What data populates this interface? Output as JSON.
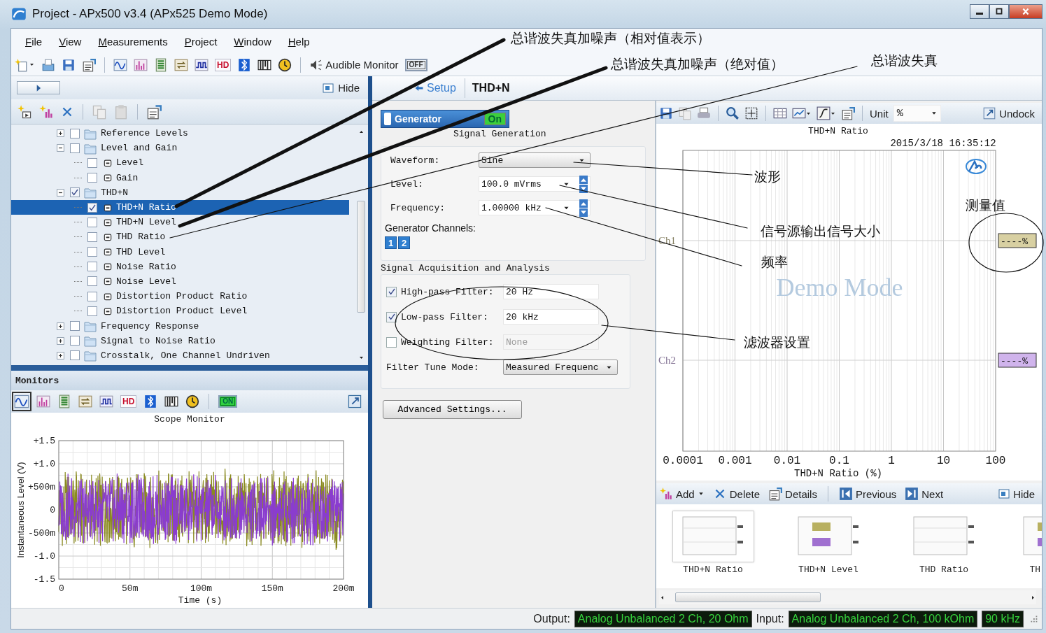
{
  "window": {
    "title": "Project - APx500 v3.4 (APx525 Demo Mode)"
  },
  "menu": [
    {
      "label": "File"
    },
    {
      "label": "View"
    },
    {
      "label": "Measurements"
    },
    {
      "label": "Project"
    },
    {
      "label": "Window"
    },
    {
      "label": "Help"
    }
  ],
  "toolbar": {
    "hd_label": "HD",
    "audible_monitor": "Audible Monitor",
    "monitor_switch": {
      "label": "OFF",
      "on": false
    }
  },
  "navigator": {
    "hide_button": "Hide",
    "tree": [
      {
        "label": "Reference Levels",
        "kind": "folder",
        "checked": false,
        "expanded": false,
        "selected": false
      },
      {
        "label": "Level and Gain",
        "kind": "folder",
        "checked": false,
        "expanded": true,
        "selected": false,
        "children": [
          {
            "label": "Level",
            "kind": "measurement",
            "checked": false,
            "selected": false
          },
          {
            "label": "Gain",
            "kind": "measurement",
            "checked": false,
            "selected": false
          }
        ]
      },
      {
        "label": "THD+N",
        "kind": "folder",
        "checked": true,
        "expanded": true,
        "selected": false,
        "children": [
          {
            "label": "THD+N Ratio",
            "kind": "measurement",
            "checked": true,
            "selected": true
          },
          {
            "label": "THD+N Level",
            "kind": "measurement",
            "checked": false,
            "selected": false
          },
          {
            "label": "THD Ratio",
            "kind": "measurement",
            "checked": false,
            "selected": false
          },
          {
            "label": "THD Level",
            "kind": "measurement",
            "checked": false,
            "selected": false
          },
          {
            "label": "Noise Ratio",
            "kind": "measurement",
            "checked": false,
            "selected": false
          },
          {
            "label": "Noise Level",
            "kind": "measurement",
            "checked": false,
            "selected": false
          },
          {
            "label": "Distortion Product Ratio",
            "kind": "measurement",
            "checked": false,
            "selected": false
          },
          {
            "label": "Distortion Product Level",
            "kind": "measurement",
            "checked": false,
            "selected": false
          }
        ]
      },
      {
        "label": "Frequency Response",
        "kind": "folder",
        "checked": false,
        "expanded": false,
        "selected": false
      },
      {
        "label": "Signal to Noise Ratio",
        "kind": "folder",
        "checked": false,
        "expanded": false,
        "selected": false
      },
      {
        "label": "Crosstalk, One Channel Undriven",
        "kind": "folder",
        "checked": false,
        "expanded": false,
        "selected": false
      }
    ]
  },
  "monitors": {
    "title": "Monitors",
    "hd_label": "HD",
    "monitor_switch": {
      "label": "ON",
      "on": true
    },
    "scope": {
      "title": "Scope Monitor",
      "ylabel": "Instantaneous Level (V)",
      "yticks": [
        "+1.5",
        "+1.0",
        "+500m",
        "0",
        "-500m",
        "-1.0",
        "-1.5"
      ],
      "xticks": [
        "0",
        "50m",
        "100m",
        "150m",
        "200m"
      ],
      "xlabel": "Time (s)"
    }
  },
  "setup": {
    "back_link": "Setup",
    "title": "THD+N",
    "generator": {
      "label": "Generator",
      "status": "On",
      "on": true
    },
    "signal_generation": {
      "title": "Signal Generation",
      "fields": [
        {
          "label": "Waveform:",
          "value": "Sine",
          "kind": "dropdown"
        },
        {
          "label": "Level:",
          "value": "100.0 mVrms",
          "kind": "spinner"
        },
        {
          "label": "Frequency:",
          "value": "1.00000 kHz",
          "kind": "spinner"
        }
      ]
    },
    "generator_channels": {
      "label": "Generator Channels:",
      "channels": [
        {
          "label": "1",
          "selected": true
        },
        {
          "label": "2",
          "selected": true
        }
      ]
    },
    "acquisition": {
      "title": "Signal Acquisition and Analysis",
      "filters": [
        {
          "label": "High-pass Filter:",
          "value": "20 Hz",
          "checked": true
        },
        {
          "label": "Low-pass Filter:",
          "value": "20 kHz",
          "checked": true
        },
        {
          "label": "Weighting Filter:",
          "value": "None",
          "checked": false
        }
      ],
      "tune_mode": {
        "label": "Filter Tune Mode:",
        "value": "Measured Frequenc"
      }
    },
    "advanced_button": "Advanced Settings..."
  },
  "graph": {
    "unit_label": "Unit",
    "unit_value": "%",
    "undock_button": "Undock",
    "title": "THD+N Ratio",
    "timestamp": "2015/3/18 16:35:12",
    "watermark": "Demo Mode",
    "channels": [
      {
        "name": "Ch1",
        "reading": "----%",
        "color": "#d8d0a2"
      },
      {
        "name": "Ch2",
        "reading": "----%",
        "color": "#d0b4ec"
      }
    ],
    "xticks": [
      "0.0001",
      "0.001",
      "0.01",
      "0.1",
      "1",
      "10",
      "100"
    ],
    "xlabel": "THD+N Ratio (%)"
  },
  "results": {
    "buttons": [
      {
        "label": "Add",
        "kind": "dropdown"
      },
      {
        "label": "Delete",
        "kind": "plain"
      },
      {
        "label": "Details",
        "kind": "plain"
      },
      {
        "label": "Previous",
        "kind": "plain"
      },
      {
        "label": "Next",
        "kind": "plain"
      }
    ],
    "hide_button": "Hide",
    "thumbnails": [
      {
        "label": "THD+N Ratio",
        "selected": true
      },
      {
        "label": "THD+N Level",
        "selected": false
      },
      {
        "label": "THD Ratio",
        "selected": false
      },
      {
        "label": "TH",
        "selected": false
      }
    ]
  },
  "status_bar": {
    "output_label": "Output:",
    "output_value": "Analog Unbalanced 2 Ch, 20 Ohm",
    "input_label": "Input:",
    "input_value": "Analog Unbalanced 2 Ch, 100 kOhm",
    "bandwidth": "90 kHz"
  },
  "annotations": [
    {
      "text": "总谐波失真加噪声（相对值表示）"
    },
    {
      "text": "总谐波失真加噪声（绝对值）"
    },
    {
      "text": "总谐波失真"
    },
    {
      "text": "波形"
    },
    {
      "text": "测量值"
    },
    {
      "text": "信号源输出信号大小"
    },
    {
      "text": "频率"
    },
    {
      "text": "滤波器设置"
    }
  ]
}
